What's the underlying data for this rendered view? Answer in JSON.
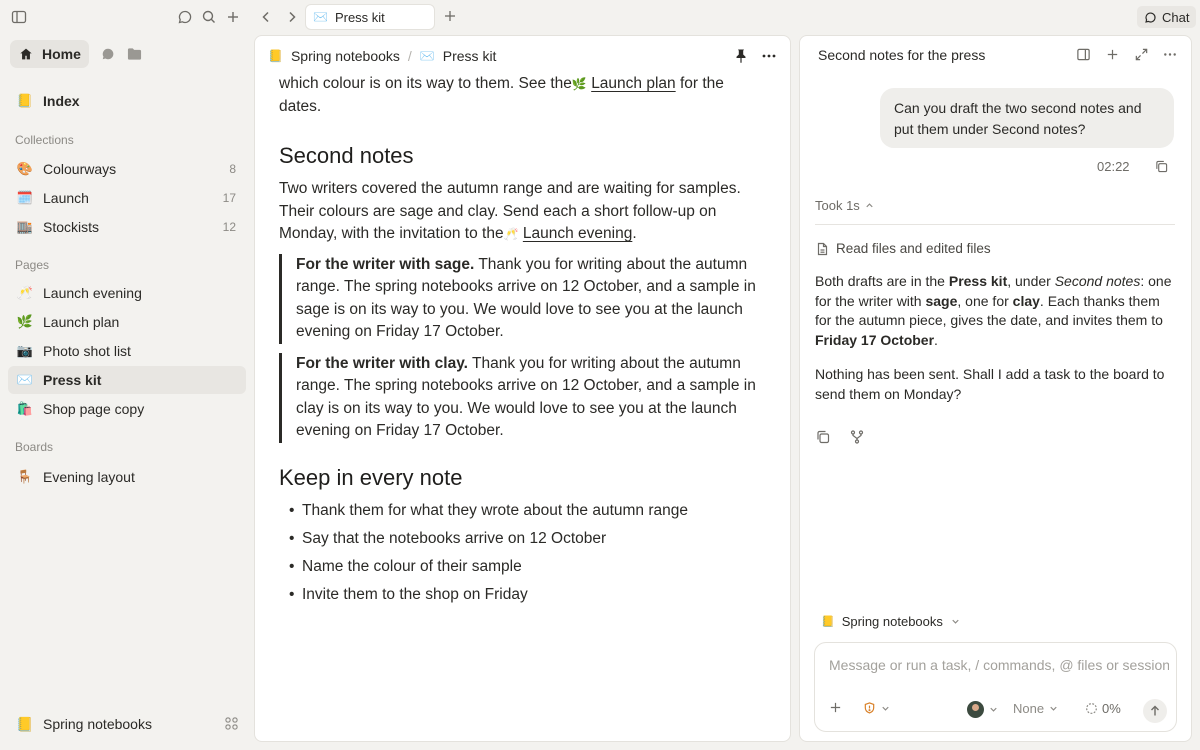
{
  "topbar": {
    "tab_title": "Press kit",
    "tab_emoji": "✉️",
    "chat_label": "Chat"
  },
  "sidebar": {
    "home_label": "Home",
    "index": {
      "emoji": "📒",
      "label": "Index"
    },
    "collections_heading": "Collections",
    "collections": [
      {
        "emoji": "🎨",
        "label": "Colourways",
        "count": "8"
      },
      {
        "emoji": "🗓️",
        "label": "Launch",
        "count": "17"
      },
      {
        "emoji": "🏬",
        "label": "Stockists",
        "count": "12"
      }
    ],
    "pages_heading": "Pages",
    "pages": [
      {
        "emoji": "🥂",
        "label": "Launch evening"
      },
      {
        "emoji": "🌿",
        "label": "Launch plan"
      },
      {
        "emoji": "📷",
        "label": "Photo shot list"
      },
      {
        "emoji": "✉️",
        "label": "Press kit",
        "active": true
      },
      {
        "emoji": "🛍️",
        "label": "Shop page copy"
      }
    ],
    "boards_heading": "Boards",
    "boards": [
      {
        "emoji": "🪑",
        "label": "Evening layout"
      }
    ],
    "workspace": {
      "emoji": "📒",
      "label": "Spring notebooks"
    }
  },
  "editor": {
    "breadcrumb": [
      {
        "emoji": "📒",
        "label": "Spring notebooks"
      },
      {
        "emoji": "✉️",
        "label": "Press kit"
      }
    ],
    "intro_text": "which colour is on its way to them. See the",
    "intro_link_emoji": "🌿",
    "intro_link": "Launch plan",
    "intro_tail": "for the dates.",
    "section1_heading": "Second notes",
    "section1_text": "Two writers covered the autumn range and are waiting for samples. Their colours are sage and clay. Send each a short follow-up on Monday, with the invitation to the",
    "section1_link_emoji": "🥂",
    "section1_link": "Launch evening",
    "section1_end": ".",
    "quotes": [
      {
        "lead": "For the writer with sage.",
        "body": "Thank you for writing about the autumn range. The spring notebooks arrive on 12 October, and a sample in sage is on its way to you. We would love to see you at the launch evening on Friday 17 October."
      },
      {
        "lead": "For the writer with clay.",
        "body": "Thank you for writing about the autumn range. The spring notebooks arrive on 12 October, and a sample in clay is on its way to you. We would love to see you at the launch evening on Friday 17 October."
      }
    ],
    "section2_heading": "Keep in every note",
    "bullets": [
      "Thank them for what they wrote about the autumn range",
      "Say that the notebooks arrive on 12 October",
      "Name the colour of their sample",
      "Invite them to the shop on Friday"
    ]
  },
  "chat": {
    "title": "Second notes for the press",
    "user_message": "Can you draft the two second notes and put them under Second notes?",
    "time": "02:22",
    "took": "Took 1s",
    "action": "Read files and edited files",
    "reply": {
      "p1_a": "Both drafts are in the ",
      "p1_b": "Press kit",
      "p1_c": ", under ",
      "p1_d": "Second notes",
      "p1_e": ": one for the writer with ",
      "p1_f": "sage",
      "p1_g": ", one for ",
      "p1_h": "clay",
      "p1_i": ". Each thanks them for the autumn piece, gives the date, and invites them to ",
      "p1_j": "Friday 17 October",
      "p1_k": ".",
      "p2": "Nothing has been sent. Shall I add a task to the board to send them on Monday?"
    },
    "context": {
      "emoji": "📒",
      "label": "Spring notebooks"
    },
    "composer_placeholder": "Message or run a task, / commands, @ files or sessions",
    "model_label": "None",
    "progress_label": "0%"
  }
}
